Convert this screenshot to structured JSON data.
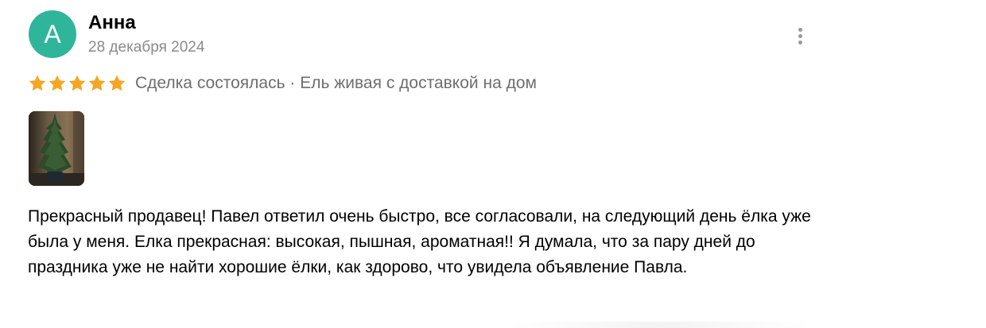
{
  "review": {
    "author": {
      "avatar_letter": "А",
      "avatar_color": "#2fb59a",
      "name": "Анна"
    },
    "date": "28 декабря 2024",
    "menu_icon": "more-vertical-icon",
    "rating": {
      "value": 5,
      "max": 5,
      "star_color": "#f5a623"
    },
    "meta_text": "Сделка состоялась · Ель живая с доставкой на дом",
    "photo": {
      "icon": "christmas-tree-photo"
    },
    "text": "Прекрасный продавец! Павел ответил очень быстро, все согласовали, на следующий день ёлка уже была у меня. Елка прекрасная: высокая, пышная, ароматная!! Я думала, что за пару дней до праздника уже не найти хорошие ёлки, как здорово, что увидела объявление Павла."
  }
}
